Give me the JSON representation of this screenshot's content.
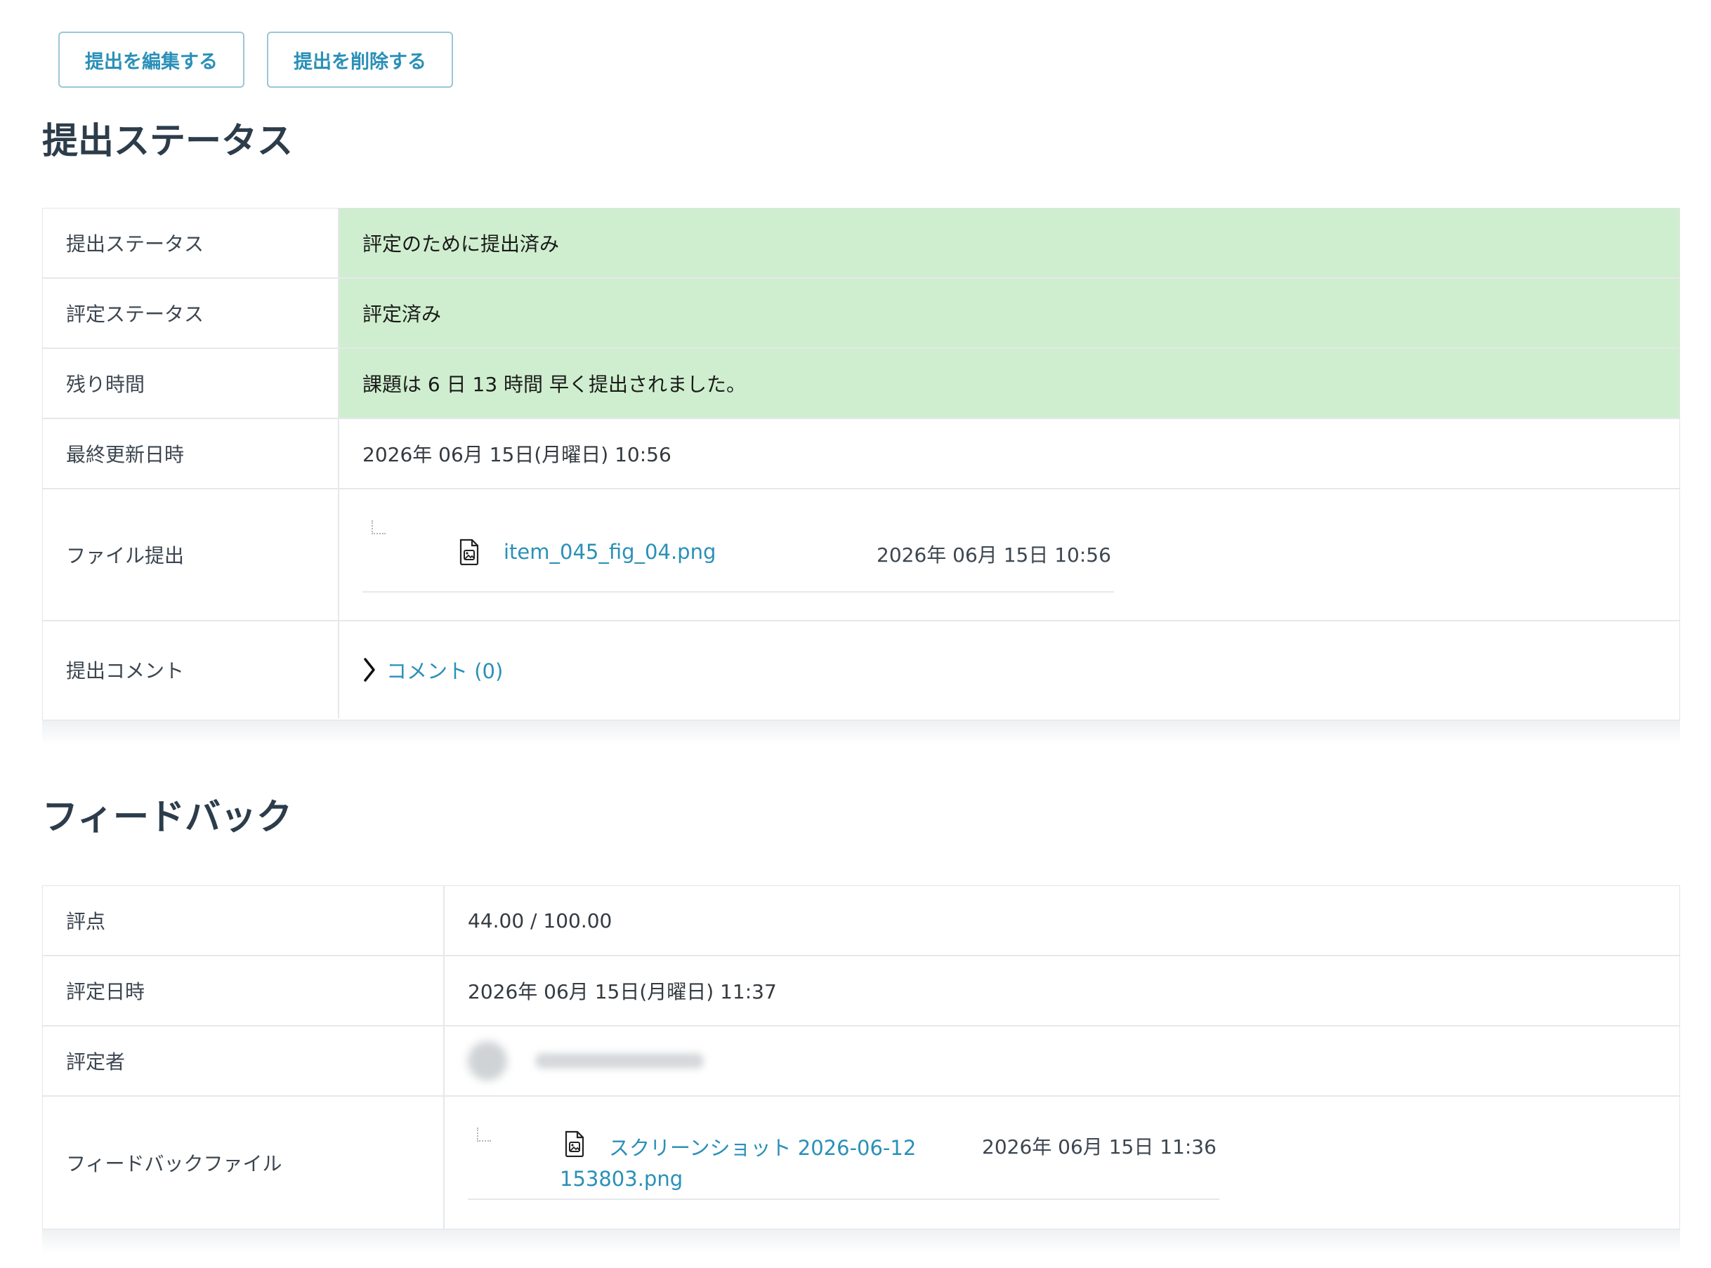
{
  "actions": {
    "edit_label": "提出を編集する",
    "delete_label": "提出を削除する"
  },
  "submission": {
    "title": "提出ステータス",
    "rows": [
      {
        "label": "提出ステータス",
        "value": "評定のために提出済み"
      },
      {
        "label": "評定ステータス",
        "value": "評定済み"
      },
      {
        "label": "残り時間",
        "value": "課題は 6 日 13 時間 早く提出されました。"
      },
      {
        "label": "最終更新日時",
        "value": "2026年 06月 15日(月曜日) 10:56"
      }
    ],
    "file": {
      "label": "ファイル提出",
      "name": "item_045_fig_04.png",
      "date": "2026年 06月 15日 10:56",
      "icon": "image-file-icon"
    },
    "comment": {
      "label": "提出コメント",
      "link": "コメント (0)",
      "icon": "chevron-right-icon"
    },
    "highlight_color": "#cfeecf"
  },
  "feedback": {
    "title": "フィードバック",
    "rows": [
      {
        "label": "評点",
        "value": "44.00 / 100.00"
      },
      {
        "label": "評定日時",
        "value": "2026年 06月 15日(月曜日) 11:37"
      }
    ],
    "grader": {
      "label": "評定者"
    },
    "file": {
      "label": "フィードバックファイル",
      "name_line1": "スクリーンショット 2026-06-12",
      "name_line2": "153803.png",
      "date": "2026年 06月 15日 11:36",
      "icon": "image-file-icon"
    }
  },
  "colors": {
    "link": "#2a90b8",
    "heading": "#2c3c4a",
    "button_border": "#9bc6d8"
  }
}
